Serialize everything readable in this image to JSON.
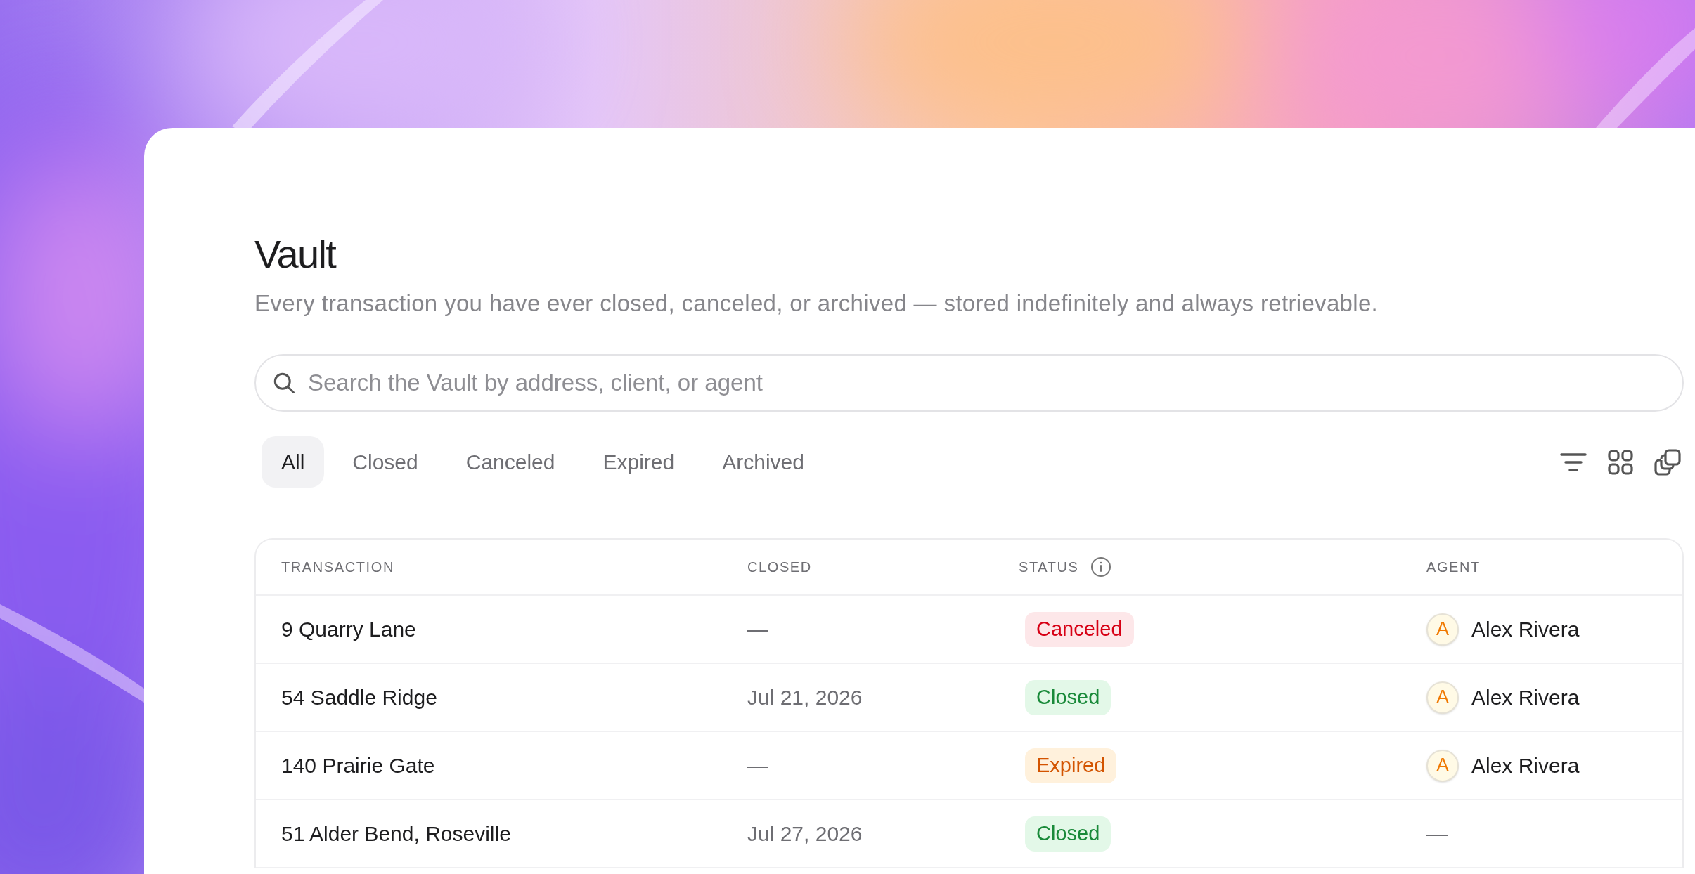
{
  "title": "Vault",
  "subtitle": "Every transaction you have ever closed, canceled, or archived — stored indefinitely and always retrievable.",
  "search": {
    "placeholder": "Search the Vault by address, client, or agent"
  },
  "tabs": [
    {
      "label": "All",
      "selected": true
    },
    {
      "label": "Closed",
      "selected": false
    },
    {
      "label": "Canceled",
      "selected": false
    },
    {
      "label": "Expired",
      "selected": false
    },
    {
      "label": "Archived",
      "selected": false
    }
  ],
  "table": {
    "columns": [
      "TRANSACTION",
      "CLOSED",
      "STATUS",
      "AGENT"
    ],
    "rows": [
      {
        "transaction": "9 Quarry Lane",
        "closed": "—",
        "status": {
          "label": "Canceled",
          "kind": "canceled"
        },
        "agent": {
          "kind": "person",
          "initial": "A",
          "name": "Alex Rivera"
        }
      },
      {
        "transaction": "54 Saddle Ridge",
        "closed": "Jul 21, 2026",
        "status": {
          "label": "Closed",
          "kind": "closed"
        },
        "agent": {
          "kind": "person",
          "initial": "A",
          "name": "Alex Rivera"
        }
      },
      {
        "transaction": "140 Prairie Gate",
        "closed": "—",
        "status": {
          "label": "Expired",
          "kind": "expired"
        },
        "agent": {
          "kind": "person",
          "initial": "A",
          "name": "Alex Rivera"
        }
      },
      {
        "transaction": "51 Alder Bend, Roseville",
        "closed": "Jul 27, 2026",
        "status": {
          "label": "Closed",
          "kind": "closed"
        },
        "agent": {
          "kind": "none",
          "text": "—"
        }
      }
    ]
  }
}
